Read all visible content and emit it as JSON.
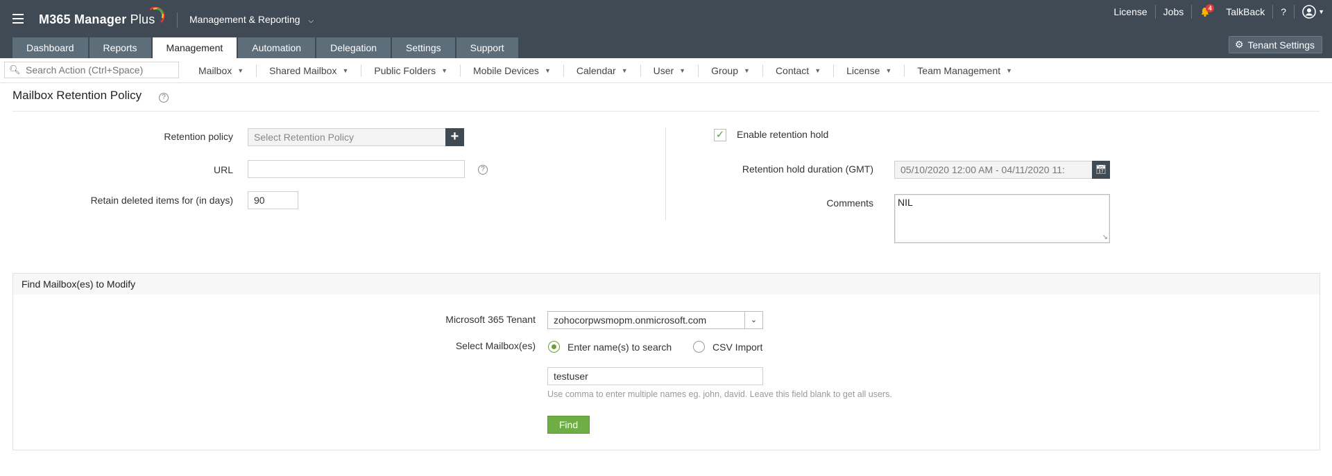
{
  "header": {
    "app_name": "M365 Manager",
    "app_name_suffix": "Plus",
    "module": "Management & Reporting",
    "top_links": {
      "license": "License",
      "jobs": "Jobs",
      "notifications_count": "4",
      "talkback": "TalkBack",
      "help": "?"
    },
    "tabs": [
      "Dashboard",
      "Reports",
      "Management",
      "Automation",
      "Delegation",
      "Settings",
      "Support"
    ],
    "active_tab": "Management",
    "tenant_settings": "Tenant Settings",
    "accent_color": "#3f4a54"
  },
  "actionbar": {
    "search_placeholder": "Search Action (Ctrl+Space)",
    "menus": [
      "Mailbox",
      "Shared Mailbox",
      "Public Folders",
      "Mobile Devices",
      "Calendar",
      "User",
      "Group",
      "Contact",
      "License",
      "Team Management"
    ]
  },
  "page": {
    "title": "Mailbox Retention Policy",
    "retention_policy_label": "Retention policy",
    "retention_policy_placeholder": "Select Retention Policy",
    "url_label": "URL",
    "url_value": "",
    "retain_deleted_label": "Retain deleted items for (in days)",
    "retain_deleted_value": "90",
    "enable_hold_label": "Enable retention hold",
    "enable_hold_checked": true,
    "hold_duration_label": "Retention hold duration (GMT)",
    "hold_duration_value": "05/10/2020 12:00 AM - 04/11/2020 11:",
    "comments_label": "Comments",
    "comments_value": "NIL"
  },
  "find": {
    "heading": "Find Mailbox(es) to Modify",
    "tenant_label": "Microsoft 365 Tenant",
    "tenant_value": "zohocorpwsmopm.onmicrosoft.com",
    "select_label": "Select Mailbox(es)",
    "option_search": "Enter name(s) to search",
    "option_csv": "CSV Import",
    "selected_option": "search",
    "names_value": "testuser",
    "hint": "Use comma to enter multiple names eg. john, david. Leave this field blank to get all users.",
    "find_button": "Find",
    "button_color": "#6eae45"
  }
}
